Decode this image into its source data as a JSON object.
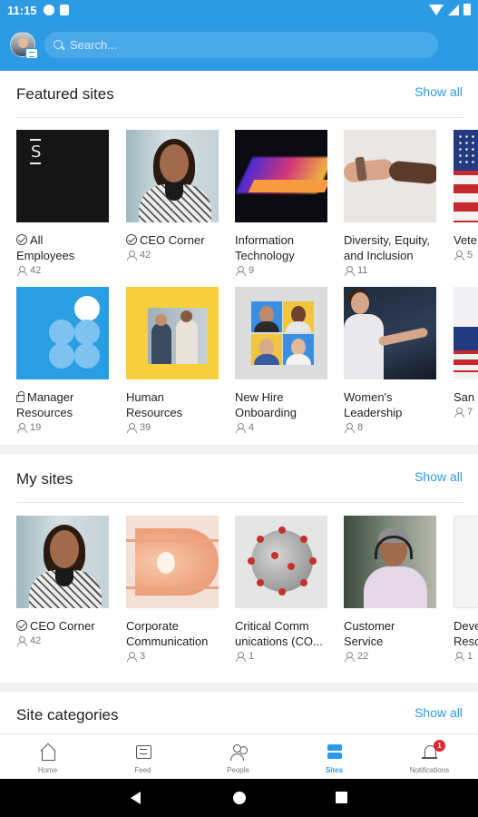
{
  "status_bar": {
    "time": "11:15"
  },
  "header": {
    "search_placeholder": "Search..."
  },
  "featured": {
    "title": "Featured sites",
    "show_all": "Show all",
    "row1": [
      {
        "name1": "All",
        "name2": "Employees",
        "count": "42",
        "badge": "check"
      },
      {
        "name1": "CEO Corner",
        "name2": "",
        "count": "42",
        "badge": "check"
      },
      {
        "name1": "Information",
        "name2": "Technology",
        "count": "9",
        "badge": ""
      },
      {
        "name1": "Diversity, Equity,",
        "name2": "and Inclusion",
        "count": "11",
        "badge": ""
      },
      {
        "name1": "Vete",
        "name2": "",
        "count": "5",
        "badge": ""
      }
    ],
    "row2": [
      {
        "name1": "Manager",
        "name2": "Resources",
        "count": "19",
        "badge": "lock"
      },
      {
        "name1": "Human",
        "name2": "Resources",
        "count": "39",
        "badge": ""
      },
      {
        "name1": "New Hire",
        "name2": "Onboarding",
        "count": "4",
        "badge": ""
      },
      {
        "name1": "Women's",
        "name2": "Leadership",
        "count": "8",
        "badge": ""
      },
      {
        "name1": "San",
        "name2": "",
        "count": "7",
        "badge": ""
      }
    ]
  },
  "my_sites": {
    "title": "My sites",
    "show_all": "Show all",
    "items": [
      {
        "name1": "CEO Corner",
        "name2": "",
        "count": "42",
        "badge": "check"
      },
      {
        "name1": "Corporate",
        "name2": "Communication",
        "count": "3",
        "badge": ""
      },
      {
        "name1": "Critical Comm",
        "name2": "unications (CO...",
        "count": "1",
        "badge": ""
      },
      {
        "name1": "Customer",
        "name2": "Service",
        "count": "22",
        "badge": ""
      },
      {
        "name1": "Deve",
        "name2": "Reso",
        "count": "1",
        "badge": ""
      }
    ]
  },
  "site_categories": {
    "title": "Site categories",
    "show_all": "Show all"
  },
  "bottom_nav": {
    "items": [
      {
        "label": "Home",
        "icon": "home-icon"
      },
      {
        "label": "Feed",
        "icon": "feed-icon"
      },
      {
        "label": "People",
        "icon": "people-icon"
      },
      {
        "label": "Sites",
        "icon": "sites-icon",
        "active": true
      },
      {
        "label": "Notifications",
        "icon": "bell-icon"
      }
    ],
    "notification_count": "1"
  },
  "colors": {
    "accent": "#2d9be4",
    "badge": "#e0262c"
  }
}
